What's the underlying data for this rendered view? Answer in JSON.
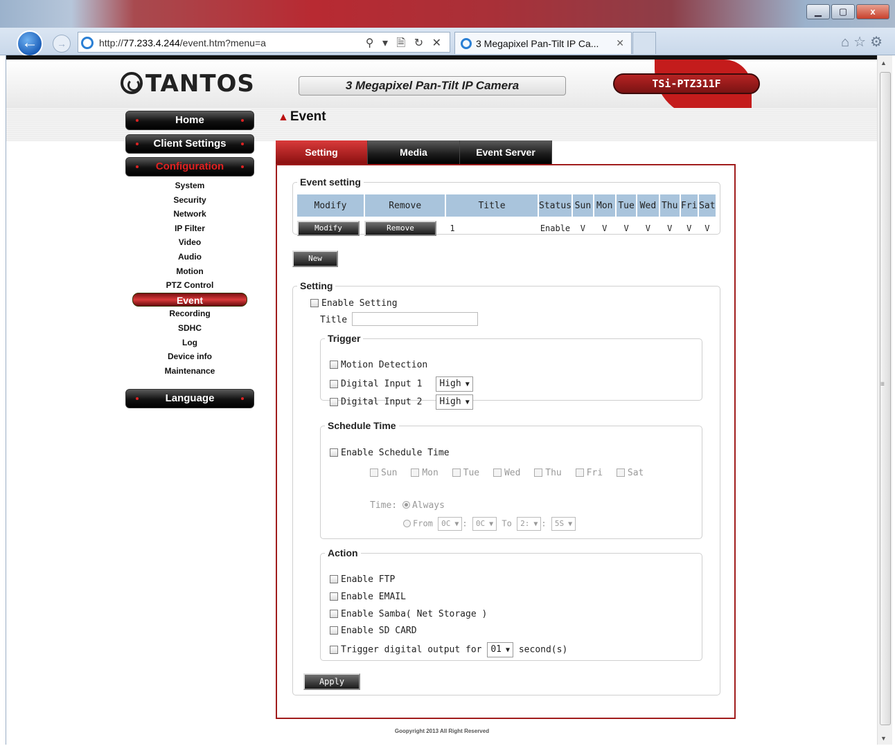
{
  "browser": {
    "url_prefix": "http://",
    "url_host": "77.233.4.244",
    "url_path": "/event.htm?menu=a",
    "address_tools": "⚲ ▾ 🗎 ↻ ✕",
    "tab_title": "3 Megapixel Pan-Tilt IP Ca...",
    "tab_close": "✕",
    "window_buttons": {
      "minimize": "▁",
      "maximize": "▢",
      "close": "x"
    },
    "icons": [
      "home-icon",
      "favorites-star-icon",
      "settings-gear-icon"
    ]
  },
  "header": {
    "logo": "TANTOS",
    "product": "3 Megapixel Pan-Tilt IP Camera",
    "model": "TSi-PTZ311F"
  },
  "menu": {
    "home": "Home",
    "client_settings": "Client Settings",
    "configuration": "Configuration",
    "language": "Language",
    "items": [
      "System",
      "Security",
      "Network",
      "IP Filter",
      "Video",
      "Audio",
      "Motion",
      "PTZ Control",
      "Event",
      "Recording",
      "SDHC",
      "Log",
      "Device info",
      "Maintenance"
    ],
    "selected": "Event"
  },
  "page": {
    "title": "Event",
    "tabs": [
      "Setting",
      "Media",
      "Event Server"
    ],
    "active_tab": "Setting"
  },
  "event_setting": {
    "legend": "Event setting",
    "columns": [
      "Modify",
      "Remove",
      "Title",
      "Status",
      "Sun",
      "Mon",
      "Tue",
      "Wed",
      "Thu",
      "Fri",
      "Sat"
    ],
    "rows": [
      {
        "modify_label": "Modify",
        "remove_label": "Remove",
        "title": "1",
        "status": "Enable",
        "days": [
          "V",
          "V",
          "V",
          "V",
          "V",
          "V",
          "V"
        ]
      }
    ],
    "new_label": "New"
  },
  "setting": {
    "legend": "Setting",
    "enable_setting": "Enable Setting",
    "title_label": "Title",
    "title_value": ""
  },
  "trigger": {
    "legend": "Trigger",
    "motion": "Motion Detection",
    "di1": "Digital Input 1",
    "di1_level": "High",
    "di2": "Digital Input 2",
    "di2_level": "High"
  },
  "schedule": {
    "legend": "Schedule Time",
    "enable": "Enable Schedule Time",
    "days": [
      "Sun",
      "Mon",
      "Tue",
      "Wed",
      "Thu",
      "Fri",
      "Sat"
    ],
    "time_label": "Time:",
    "always": "Always",
    "from": "From",
    "from_hour": "0C",
    "from_min": "0C",
    "to": "To",
    "to_hour": "2:",
    "to_min": "5S",
    "colon": ":"
  },
  "action": {
    "legend": "Action",
    "ftp": "Enable FTP",
    "email": "Enable EMAIL",
    "samba": "Enable Samba( Net Storage )",
    "sd": "Enable SD CARD",
    "trigger_output": "Trigger digital output for",
    "trigger_seconds": "01",
    "seconds_label": "second(s)"
  },
  "apply_label": "Apply",
  "footer": "Goopyright 2013 All Right Reserved",
  "colors": {
    "accent": "#c41c1c",
    "table_header": "#a9c4dc"
  }
}
